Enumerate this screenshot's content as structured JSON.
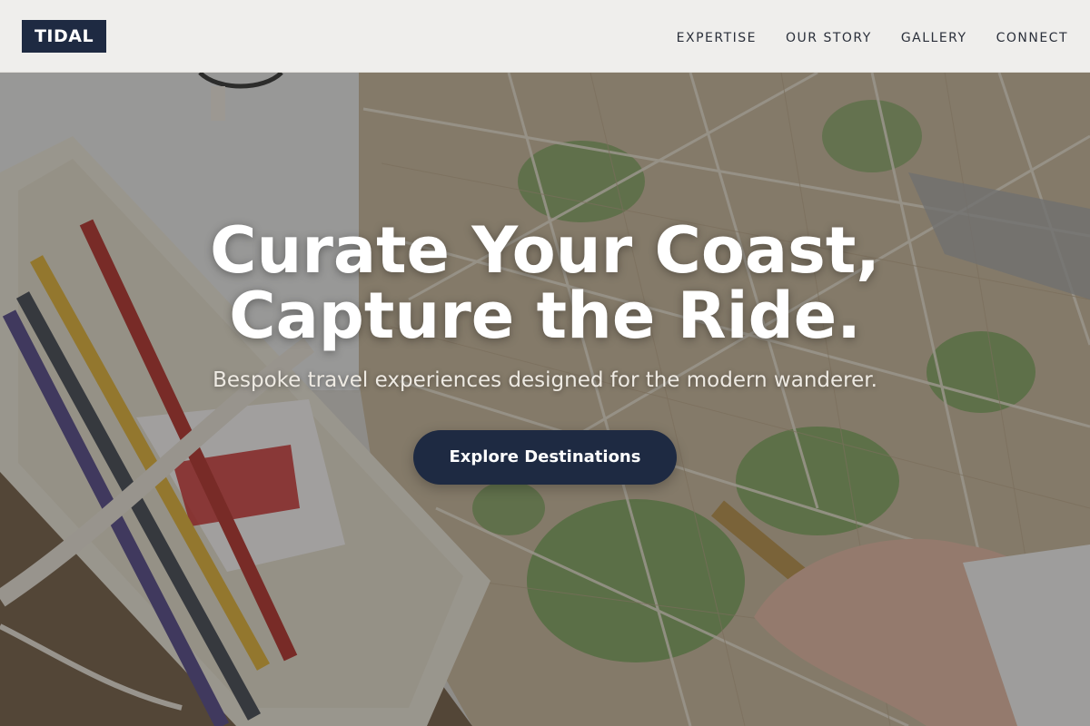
{
  "brand": {
    "logo_text": "TIDAL"
  },
  "nav": {
    "items": [
      {
        "label": "EXPERTISE"
      },
      {
        "label": "OUR STORY"
      },
      {
        "label": "GALLERY"
      },
      {
        "label": "CONNECT"
      }
    ]
  },
  "hero": {
    "title_line1": "Curate Your Coast,",
    "title_line2": "Capture the Ride.",
    "subtitle": "Bespoke travel experiences designed for the modern wanderer.",
    "cta_label": "Explore Destinations",
    "background_image": "desk-with-city-map-pencils-and-notebook"
  },
  "colors": {
    "brand_navy": "#1e2a42",
    "header_bg": "#f4f3f1",
    "nav_text": "#2a2f3a",
    "hero_text": "#ffffff"
  }
}
